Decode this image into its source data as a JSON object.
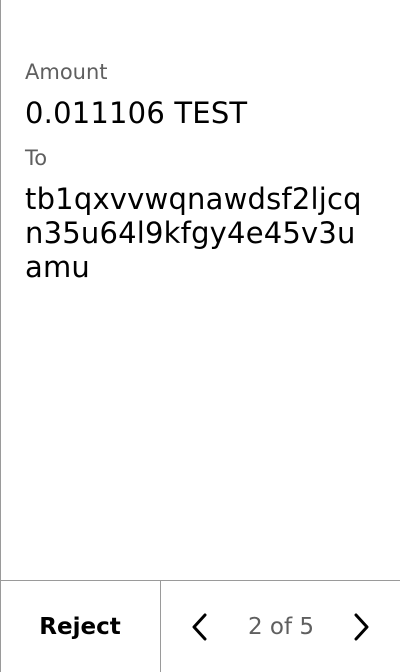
{
  "transaction": {
    "amount_label": "Amount",
    "amount_value": "0.011106 TEST",
    "to_label": "To",
    "to_address": "tb1qxvvwqnawdsf2ljcqn35u64l9kfgy4e45v3uamu"
  },
  "footer": {
    "reject_label": "Reject",
    "page_indicator": "2 of 5",
    "prev_icon": "chevron-left-icon",
    "next_icon": "chevron-right-icon"
  }
}
